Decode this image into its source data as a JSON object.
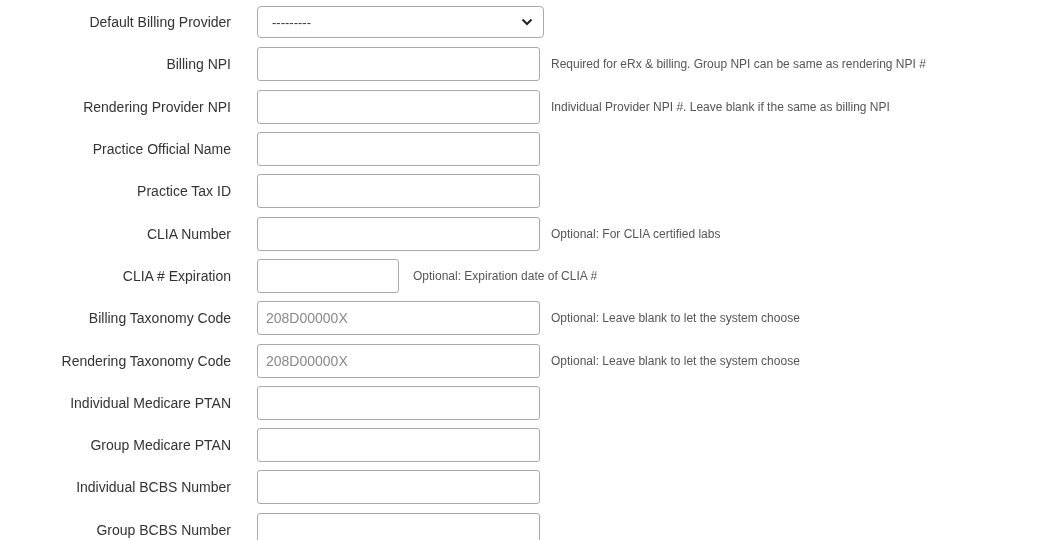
{
  "fields": [
    {
      "label": "Default Billing Provider",
      "kind": "select",
      "value": "---------"
    },
    {
      "label": "Billing NPI",
      "kind": "text",
      "hint": "Required for eRx & billing. Group NPI can be same as rendering NPI #"
    },
    {
      "label": "Rendering Provider NPI",
      "kind": "text",
      "hint": "Individual Provider NPI #. Leave blank if the same as billing NPI"
    },
    {
      "label": "Practice Official Name",
      "kind": "text"
    },
    {
      "label": "Practice Tax ID",
      "kind": "text"
    },
    {
      "label": "CLIA Number",
      "kind": "text",
      "hint": "Optional: For CLIA certified labs"
    },
    {
      "label": "CLIA # Expiration",
      "kind": "short",
      "hint": "Optional: Expiration date of CLIA #"
    },
    {
      "label": "Billing Taxonomy Code",
      "kind": "text",
      "placeholder": "208D00000X",
      "hint": "Optional: Leave blank to let the system choose"
    },
    {
      "label": "Rendering Taxonomy Code",
      "kind": "text",
      "placeholder": "208D00000X",
      "hint": "Optional: Leave blank to let the system choose"
    },
    {
      "label": "Individual Medicare PTAN",
      "kind": "text"
    },
    {
      "label": "Group Medicare PTAN",
      "kind": "text"
    },
    {
      "label": "Individual BCBS Number",
      "kind": "text"
    },
    {
      "label": "Group BCBS Number",
      "kind": "text"
    }
  ]
}
